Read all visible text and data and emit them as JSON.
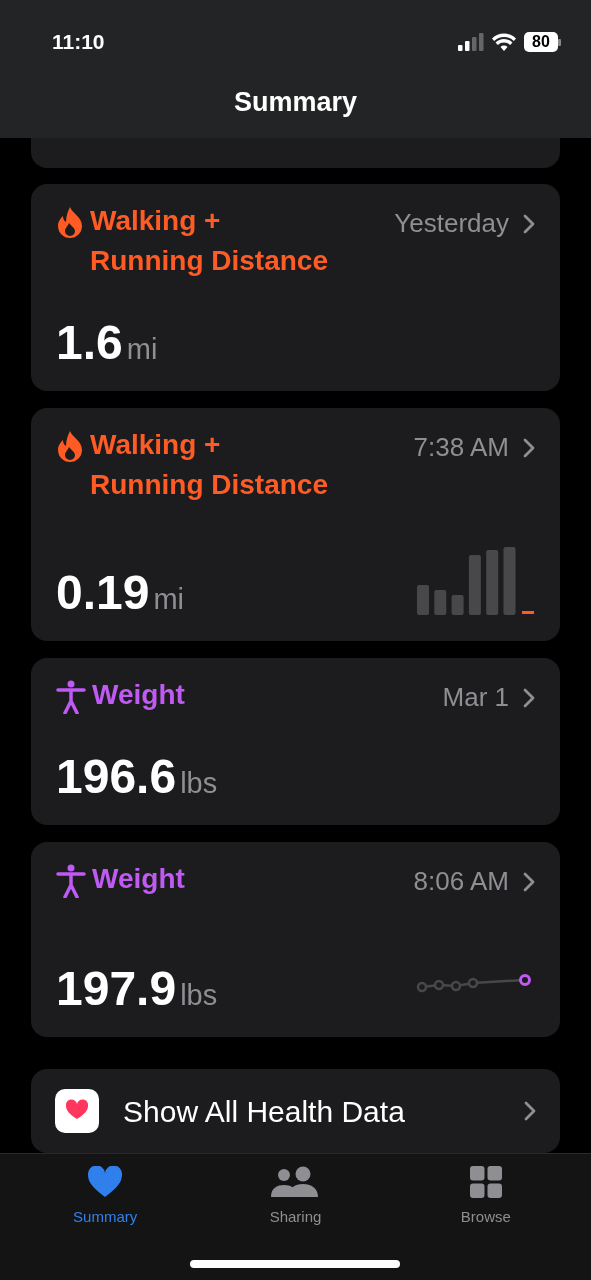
{
  "status_bar": {
    "time": "11:10",
    "battery": "80"
  },
  "title": "Summary",
  "cards": [
    {
      "kind": "distance",
      "title": "Walking +\nRunning Distance",
      "time": "Yesterday",
      "value": "1.6",
      "unit": "mi"
    },
    {
      "kind": "distance_chart",
      "title": "Walking +\nRunning Distance",
      "time": "7:38 AM",
      "value": "0.19",
      "unit": "mi"
    },
    {
      "kind": "weight",
      "title": "Weight",
      "time": "Mar 1",
      "value": "196.6",
      "unit": "lbs"
    },
    {
      "kind": "weight_chart",
      "title": "Weight",
      "time": "8:06 AM",
      "value": "197.9",
      "unit": "lbs"
    }
  ],
  "show_all": "Show All Health Data",
  "tabs": [
    {
      "label": "Summary",
      "selected": true
    },
    {
      "label": "Sharing",
      "selected": false
    },
    {
      "label": "Browse",
      "selected": false
    }
  ]
}
